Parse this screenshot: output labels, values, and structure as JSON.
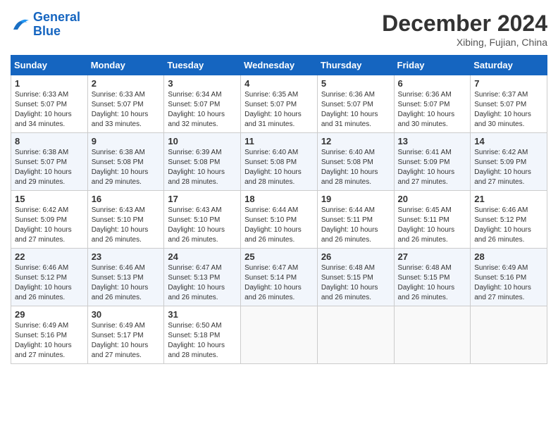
{
  "header": {
    "logo_general": "General",
    "logo_blue": "Blue",
    "month_title": "December 2024",
    "location": "Xibing, Fujian, China"
  },
  "weekdays": [
    "Sunday",
    "Monday",
    "Tuesday",
    "Wednesday",
    "Thursday",
    "Friday",
    "Saturday"
  ],
  "weeks": [
    [
      {
        "day": "1",
        "sunrise": "6:33 AM",
        "sunset": "5:07 PM",
        "daylight": "10 hours and 34 minutes."
      },
      {
        "day": "2",
        "sunrise": "6:33 AM",
        "sunset": "5:07 PM",
        "daylight": "10 hours and 33 minutes."
      },
      {
        "day": "3",
        "sunrise": "6:34 AM",
        "sunset": "5:07 PM",
        "daylight": "10 hours and 32 minutes."
      },
      {
        "day": "4",
        "sunrise": "6:35 AM",
        "sunset": "5:07 PM",
        "daylight": "10 hours and 31 minutes."
      },
      {
        "day": "5",
        "sunrise": "6:36 AM",
        "sunset": "5:07 PM",
        "daylight": "10 hours and 31 minutes."
      },
      {
        "day": "6",
        "sunrise": "6:36 AM",
        "sunset": "5:07 PM",
        "daylight": "10 hours and 30 minutes."
      },
      {
        "day": "7",
        "sunrise": "6:37 AM",
        "sunset": "5:07 PM",
        "daylight": "10 hours and 30 minutes."
      }
    ],
    [
      {
        "day": "8",
        "sunrise": "6:38 AM",
        "sunset": "5:07 PM",
        "daylight": "10 hours and 29 minutes."
      },
      {
        "day": "9",
        "sunrise": "6:38 AM",
        "sunset": "5:08 PM",
        "daylight": "10 hours and 29 minutes."
      },
      {
        "day": "10",
        "sunrise": "6:39 AM",
        "sunset": "5:08 PM",
        "daylight": "10 hours and 28 minutes."
      },
      {
        "day": "11",
        "sunrise": "6:40 AM",
        "sunset": "5:08 PM",
        "daylight": "10 hours and 28 minutes."
      },
      {
        "day": "12",
        "sunrise": "6:40 AM",
        "sunset": "5:08 PM",
        "daylight": "10 hours and 28 minutes."
      },
      {
        "day": "13",
        "sunrise": "6:41 AM",
        "sunset": "5:09 PM",
        "daylight": "10 hours and 27 minutes."
      },
      {
        "day": "14",
        "sunrise": "6:42 AM",
        "sunset": "5:09 PM",
        "daylight": "10 hours and 27 minutes."
      }
    ],
    [
      {
        "day": "15",
        "sunrise": "6:42 AM",
        "sunset": "5:09 PM",
        "daylight": "10 hours and 27 minutes."
      },
      {
        "day": "16",
        "sunrise": "6:43 AM",
        "sunset": "5:10 PM",
        "daylight": "10 hours and 26 minutes."
      },
      {
        "day": "17",
        "sunrise": "6:43 AM",
        "sunset": "5:10 PM",
        "daylight": "10 hours and 26 minutes."
      },
      {
        "day": "18",
        "sunrise": "6:44 AM",
        "sunset": "5:10 PM",
        "daylight": "10 hours and 26 minutes."
      },
      {
        "day": "19",
        "sunrise": "6:44 AM",
        "sunset": "5:11 PM",
        "daylight": "10 hours and 26 minutes."
      },
      {
        "day": "20",
        "sunrise": "6:45 AM",
        "sunset": "5:11 PM",
        "daylight": "10 hours and 26 minutes."
      },
      {
        "day": "21",
        "sunrise": "6:46 AM",
        "sunset": "5:12 PM",
        "daylight": "10 hours and 26 minutes."
      }
    ],
    [
      {
        "day": "22",
        "sunrise": "6:46 AM",
        "sunset": "5:12 PM",
        "daylight": "10 hours and 26 minutes."
      },
      {
        "day": "23",
        "sunrise": "6:46 AM",
        "sunset": "5:13 PM",
        "daylight": "10 hours and 26 minutes."
      },
      {
        "day": "24",
        "sunrise": "6:47 AM",
        "sunset": "5:13 PM",
        "daylight": "10 hours and 26 minutes."
      },
      {
        "day": "25",
        "sunrise": "6:47 AM",
        "sunset": "5:14 PM",
        "daylight": "10 hours and 26 minutes."
      },
      {
        "day": "26",
        "sunrise": "6:48 AM",
        "sunset": "5:15 PM",
        "daylight": "10 hours and 26 minutes."
      },
      {
        "day": "27",
        "sunrise": "6:48 AM",
        "sunset": "5:15 PM",
        "daylight": "10 hours and 26 minutes."
      },
      {
        "day": "28",
        "sunrise": "6:49 AM",
        "sunset": "5:16 PM",
        "daylight": "10 hours and 27 minutes."
      }
    ],
    [
      {
        "day": "29",
        "sunrise": "6:49 AM",
        "sunset": "5:16 PM",
        "daylight": "10 hours and 27 minutes."
      },
      {
        "day": "30",
        "sunrise": "6:49 AM",
        "sunset": "5:17 PM",
        "daylight": "10 hours and 27 minutes."
      },
      {
        "day": "31",
        "sunrise": "6:50 AM",
        "sunset": "5:18 PM",
        "daylight": "10 hours and 28 minutes."
      },
      null,
      null,
      null,
      null
    ]
  ]
}
